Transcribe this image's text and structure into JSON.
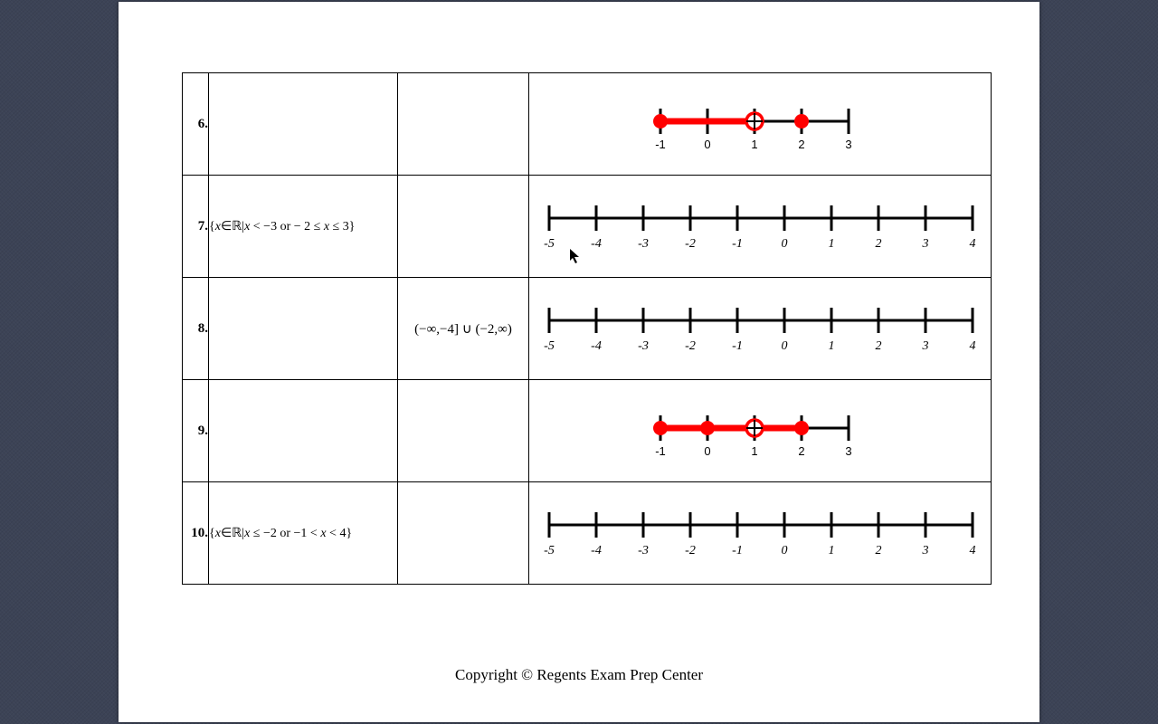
{
  "rows": [
    {
      "num": "6.",
      "notation": "",
      "interval": "",
      "nl": {
        "type": "small",
        "min": -1,
        "max": 3,
        "labels": [
          -1,
          0,
          1,
          2,
          3
        ],
        "segments": [
          [
            -1,
            1,
            "red"
          ]
        ],
        "points": [
          {
            "x": -1,
            "t": "closed"
          },
          {
            "x": 1,
            "t": "open"
          },
          {
            "x": 2,
            "t": "closed"
          }
        ]
      }
    },
    {
      "num": "7.",
      "notation": "{x∈ℝ|x < −3  or  − 2 ≤ x ≤ 3}",
      "interval": "",
      "nl": {
        "type": "big",
        "min": -5,
        "max": 4,
        "labels": [
          -5,
          -4,
          -3,
          -2,
          -1,
          0,
          1,
          2,
          3,
          4
        ],
        "segments": [],
        "points": []
      }
    },
    {
      "num": "8.",
      "notation": "",
      "interval": "(−∞,−4]  ∪  (−2,∞)",
      "nl": {
        "type": "big",
        "min": -5,
        "max": 4,
        "labels": [
          -5,
          -4,
          -3,
          -2,
          -1,
          0,
          1,
          2,
          3,
          4
        ],
        "segments": [],
        "points": []
      }
    },
    {
      "num": "9.",
      "notation": "",
      "interval": "",
      "nl": {
        "type": "small",
        "min": -1,
        "max": 3,
        "labels": [
          -1,
          0,
          1,
          2,
          3
        ],
        "segments": [
          [
            -1,
            1,
            "red"
          ],
          [
            1,
            2,
            "red"
          ]
        ],
        "points": [
          {
            "x": -1,
            "t": "closed"
          },
          {
            "x": 0,
            "t": "closed"
          },
          {
            "x": 1,
            "t": "open"
          },
          {
            "x": 2,
            "t": "closed"
          }
        ]
      }
    },
    {
      "num": "10.",
      "notation": "{x∈ℝ|x ≤ −2  or  −1 < x < 4}",
      "interval": "",
      "nl": {
        "type": "big",
        "min": -5,
        "max": 4,
        "labels": [
          -5,
          -4,
          -3,
          -2,
          -1,
          0,
          1,
          2,
          3,
          4
        ],
        "segments": [],
        "points": []
      }
    }
  ],
  "copyright": "Copyright © Regents Exam Prep Center"
}
